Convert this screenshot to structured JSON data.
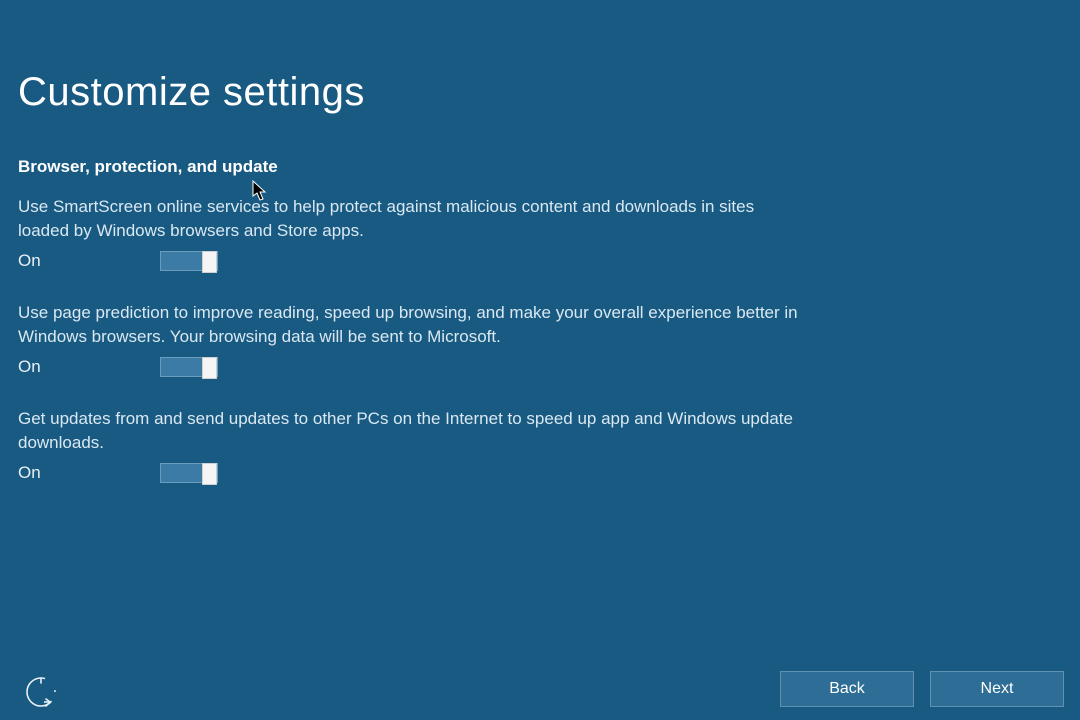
{
  "page": {
    "title": "Customize settings"
  },
  "section": {
    "title": "Browser, protection, and update"
  },
  "settings": [
    {
      "desc": "Use SmartScreen online services to help protect against malicious content and downloads in sites loaded by Windows browsers and Store apps.",
      "state_label": "On",
      "state": true
    },
    {
      "desc": "Use page prediction to improve reading, speed up browsing, and make your overall experience better in Windows browsers. Your browsing data will be sent to Microsoft.",
      "state_label": "On",
      "state": true
    },
    {
      "desc": "Get updates from and send updates to other PCs on the Internet to speed up app and Windows update downloads.",
      "state_label": "On",
      "state": true
    }
  ],
  "footer": {
    "back_label": "Back",
    "next_label": "Next"
  }
}
